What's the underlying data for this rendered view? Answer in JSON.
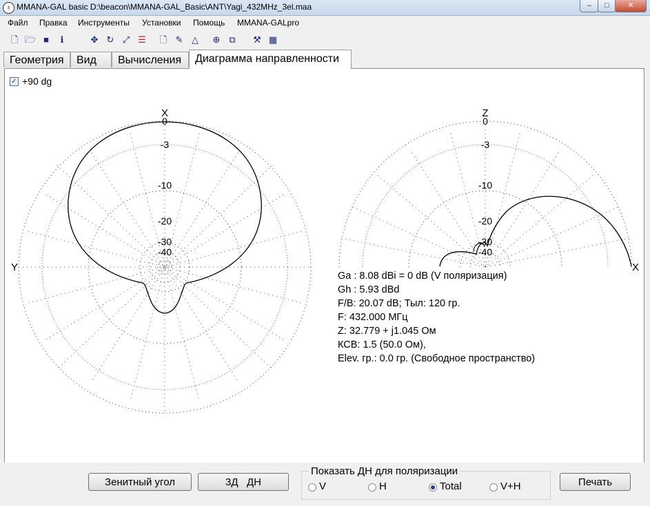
{
  "window": {
    "title": "MMANA-GAL basic D:\\beacon\\MMANA-GAL_Basic\\ANT\\Yagi_432MHz_3el.maa",
    "minimize": "–",
    "maximize": "□",
    "close": "✕"
  },
  "menu": [
    "Файл",
    "Правка",
    "Инструменты",
    "Установки",
    "Помощь",
    "MMANA-GALpro"
  ],
  "toolbar": {
    "icons": [
      "new-file-icon",
      "open-folder-icon",
      "save-icon",
      "info-icon",
      "move-icon",
      "rotate-icon",
      "zoom-icon",
      "wires-icon",
      "document-icon",
      "edit-icon",
      "triangle-icon",
      "target-icon",
      "copy-icon",
      "tools-icon",
      "calculator-icon"
    ]
  },
  "tabs": [
    "Геометрия",
    "Вид",
    "Вычисления",
    "Диаграмма направленности"
  ],
  "active_tab": 3,
  "options": {
    "plus90_label": "+90 dg",
    "plus90_checked": true
  },
  "plots": {
    "horizontal": {
      "top_label": "X",
      "left_label": "Y",
      "rings": [
        "0",
        "-3",
        "-10",
        "-20",
        "-30",
        "-40"
      ]
    },
    "vertical": {
      "top_label": "Z",
      "right_label": "X",
      "rings": [
        "0",
        "-3",
        "-10",
        "-20",
        "-30",
        "-40"
      ]
    }
  },
  "results": {
    "ga": "Ga : 8.08 dBi = 0 dB  (V поляризация)",
    "gh": "Gh : 5.93 dBd",
    "fb": "F/B: 20.07 dB; Тыл: 120 гр.",
    "freq": "F: 432.000 МГц",
    "z": "Z: 32.779 + j1.045 Ом",
    "swr": "КСВ: 1.5 (50.0 Ом),",
    "elev": "Elev. гр.: 0.0 гр. (Свободное пространство)"
  },
  "buttons": {
    "zenith": "Зенитный угол",
    "dn3d": "3Д   ДН",
    "print": "Печать"
  },
  "polarization": {
    "group_label": "Показать ДН для поляризации",
    "options": [
      "V",
      "H",
      "Total",
      "V+H"
    ],
    "selected": "Total"
  }
}
